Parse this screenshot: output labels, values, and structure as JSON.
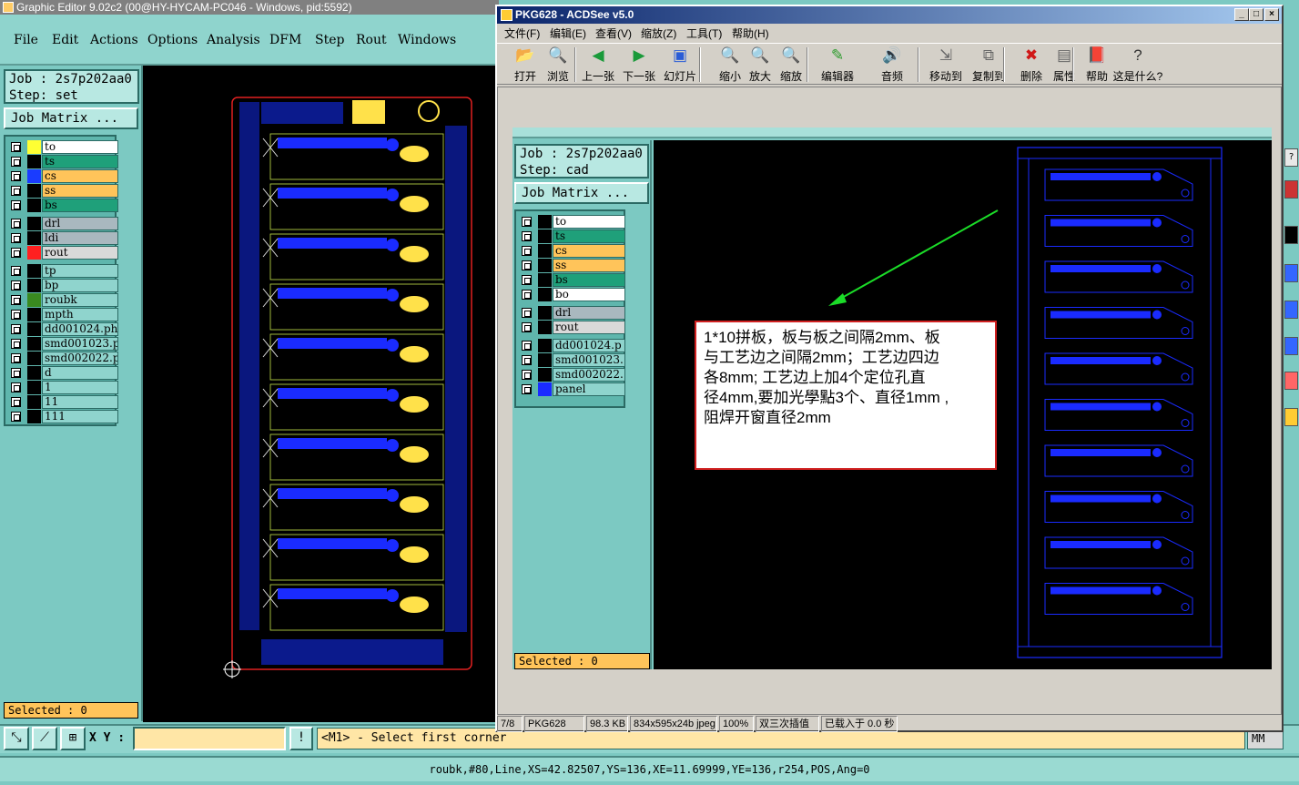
{
  "ge": {
    "title": "Graphic Editor 9.02c2 (00@HY-HYCAM-PC046 - Windows, pid:5592)",
    "menu": [
      "File",
      "Edit",
      "Actions",
      "Options",
      "Analysis",
      "DFM",
      "Step",
      "Rout",
      "Windows"
    ],
    "job": "Job : 2s7p202aa0",
    "step": "Step: set",
    "job_matrix": "Job Matrix ...",
    "layers_group1": [
      {
        "name": "to",
        "color": "#ffff33",
        "bg": "#ffffff"
      },
      {
        "name": "ts",
        "color": "#000000",
        "bg": "#1fa07a"
      },
      {
        "name": "cs",
        "color": "#1a3cff",
        "bg": "#ffc45a"
      },
      {
        "name": "ss",
        "color": "#000000",
        "bg": "#ffc45a"
      },
      {
        "name": "bs",
        "color": "#000000",
        "bg": "#1fa07a"
      }
    ],
    "layers_group2": [
      {
        "name": "drl",
        "color": "#000000",
        "bg": "#a9b8bf"
      },
      {
        "name": "ldi",
        "color": "#000000",
        "bg": "#a9b8bf"
      },
      {
        "name": "rout",
        "color": "#ff2020",
        "bg": "#d9d9d9"
      }
    ],
    "layers_group3": [
      {
        "name": "tp",
        "color": "#000000",
        "bg": "#8fd4cd"
      },
      {
        "name": "bp",
        "color": "#000000",
        "bg": "#8fd4cd"
      },
      {
        "name": "roubk",
        "color": "#3a8a20",
        "bg": "#8fd4cd"
      },
      {
        "name": "mpth",
        "color": "#000000",
        "bg": "#8fd4cd"
      },
      {
        "name": "dd001024.pho",
        "color": "#000000",
        "bg": "#8fd4cd"
      },
      {
        "name": "smd001023.pl",
        "color": "#000000",
        "bg": "#8fd4cd"
      },
      {
        "name": "smd002022.pl",
        "color": "#000000",
        "bg": "#8fd4cd"
      },
      {
        "name": "d",
        "color": "#000000",
        "bg": "#8fd4cd"
      },
      {
        "name": "1",
        "color": "#000000",
        "bg": "#8fd4cd"
      },
      {
        "name": "11",
        "color": "#000000",
        "bg": "#8fd4cd"
      },
      {
        "name": "111",
        "color": "#000000",
        "bg": "#8fd4cd"
      }
    ],
    "selected": "Selected : 0",
    "xy_label": "X Y :",
    "prompt": "<M1> - Select first corner",
    "mm": "MM",
    "status_line": "roubk,#80,Line,XS=42.82507,YS=136,XE=11.69999,YE=136,r254,POS,Ang=0"
  },
  "acdsee": {
    "title": "PKG628 - ACDSee v5.0",
    "menu": [
      "文件(F)",
      "编辑(E)",
      "查看(V)",
      "缩放(Z)",
      "工具(T)",
      "帮助(H)"
    ],
    "toolbar": [
      {
        "label": "打开",
        "icon": "folder-open-icon",
        "glyph": "📂"
      },
      {
        "label": "浏览",
        "icon": "browse-icon",
        "glyph": "🔍"
      },
      {
        "label": "上一张",
        "icon": "previous-icon",
        "glyph": "◀"
      },
      {
        "label": "下一张",
        "icon": "next-icon",
        "glyph": "▶"
      },
      {
        "label": "幻灯片",
        "icon": "slideshow-icon",
        "glyph": "▣"
      },
      {
        "label": "缩小",
        "icon": "zoom-out-icon",
        "glyph": "🔍"
      },
      {
        "label": "放大",
        "icon": "zoom-in-icon",
        "glyph": "🔍"
      },
      {
        "label": "缩放",
        "icon": "zoom-icon",
        "glyph": "🔍"
      },
      {
        "label": "编辑器",
        "icon": "editor-icon",
        "glyph": "✎"
      },
      {
        "label": "音频",
        "icon": "audio-icon",
        "glyph": "🔊"
      },
      {
        "label": "移动到",
        "icon": "move-to-icon",
        "glyph": "⇲"
      },
      {
        "label": "复制到",
        "icon": "copy-to-icon",
        "glyph": "⧉"
      },
      {
        "label": "删除",
        "icon": "delete-icon",
        "glyph": "✖"
      },
      {
        "label": "属性",
        "icon": "properties-icon",
        "glyph": "▤"
      },
      {
        "label": "帮助",
        "icon": "help-book-icon",
        "glyph": "📕"
      },
      {
        "label": "这是什么?",
        "icon": "whats-this-icon",
        "glyph": "?"
      }
    ],
    "inner": {
      "job": "Job : 2s7p202aa0",
      "step": "Step: cad",
      "job_matrix": "Job Matrix ...",
      "layers_group1": [
        {
          "name": "to",
          "bg": "#ffffff"
        },
        {
          "name": "ts",
          "bg": "#1fa07a"
        },
        {
          "name": "cs",
          "bg": "#ffc45a"
        },
        {
          "name": "ss",
          "bg": "#ffc45a"
        },
        {
          "name": "bs",
          "bg": "#1fa07a"
        },
        {
          "name": "bo",
          "bg": "#ffffff"
        }
      ],
      "layers_group2": [
        {
          "name": "drl",
          "bg": "#a9b8bf"
        },
        {
          "name": "rout",
          "bg": "#d9d9d9"
        }
      ],
      "layers_group3": [
        {
          "name": "dd001024.p",
          "bg": "#8fd4cd"
        },
        {
          "name": "smd001023.",
          "bg": "#8fd4cd"
        },
        {
          "name": "smd002022.",
          "bg": "#8fd4cd"
        },
        {
          "name": "panel",
          "bg": "#8fd4cd",
          "sw": "#1a2bff"
        }
      ],
      "selected": "Selected : 0",
      "note_lines": [
        "1*10拼板，板与板之间隔2mm、板",
        "与工艺边之间隔2mm；工艺边四边",
        "各8mm; 工艺边上加4个定位孔直",
        "径4mm,要加光學點3个、直径1mm ,",
        "阻焊开窗直径2mm"
      ]
    },
    "statusbar": [
      "7/8",
      "PKG628",
      "98.3 KB",
      "834x595x24b jpeg",
      "100%",
      "双三次插值",
      "已载入于 0.0 秒"
    ]
  }
}
